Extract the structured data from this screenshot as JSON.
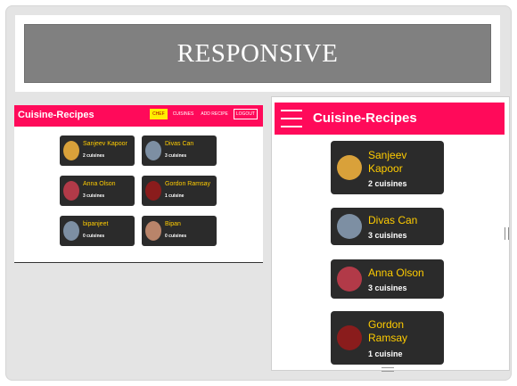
{
  "slide": {
    "title": "RESPONSIVE"
  },
  "desktop": {
    "brand": "Cuisine-Recipes",
    "nav": [
      {
        "label": "CHEF",
        "active": true
      },
      {
        "label": "CUISINES"
      },
      {
        "label": "ADD RECIPE"
      },
      {
        "label": "LOGOUT",
        "boxed": true
      }
    ],
    "chefs": [
      {
        "name": "Sanjeev Kapoor",
        "count": "2 cuisines",
        "avatar": "#d9a13a"
      },
      {
        "name": "Divas Can",
        "count": "3 cuisines",
        "avatar": "#7d8fa3"
      },
      {
        "name": "Anna Olson",
        "count": "3 cuisines",
        "avatar": "#b23a48"
      },
      {
        "name": "Gordon Ramsay",
        "count": "1 cuisine",
        "avatar": "#8a1c1c"
      },
      {
        "name": "bipanjeet",
        "count": "0 cuisines",
        "avatar": "#7d8fa3"
      },
      {
        "name": "Bipan",
        "count": "0 cuisines",
        "avatar": "#b9846a"
      }
    ]
  },
  "mobile": {
    "brand": "Cuisine-Recipes",
    "chefs": [
      {
        "name": "Sanjeev Kapoor",
        "count": "2 cuisines",
        "avatar": "#d9a13a"
      },
      {
        "name": "Divas Can",
        "count": "3 cuisines",
        "avatar": "#7d8fa3"
      },
      {
        "name": "Anna Olson",
        "count": "3 cuisines",
        "avatar": "#b23a48"
      },
      {
        "name": "Gordon Ramsay",
        "count": "1 cuisine",
        "avatar": "#8a1c1c"
      }
    ]
  },
  "colors": {
    "accent": "#ff0a5a",
    "card": "#2b2b2b",
    "name": "#ffcc00",
    "active_tab": "#ffee00"
  }
}
